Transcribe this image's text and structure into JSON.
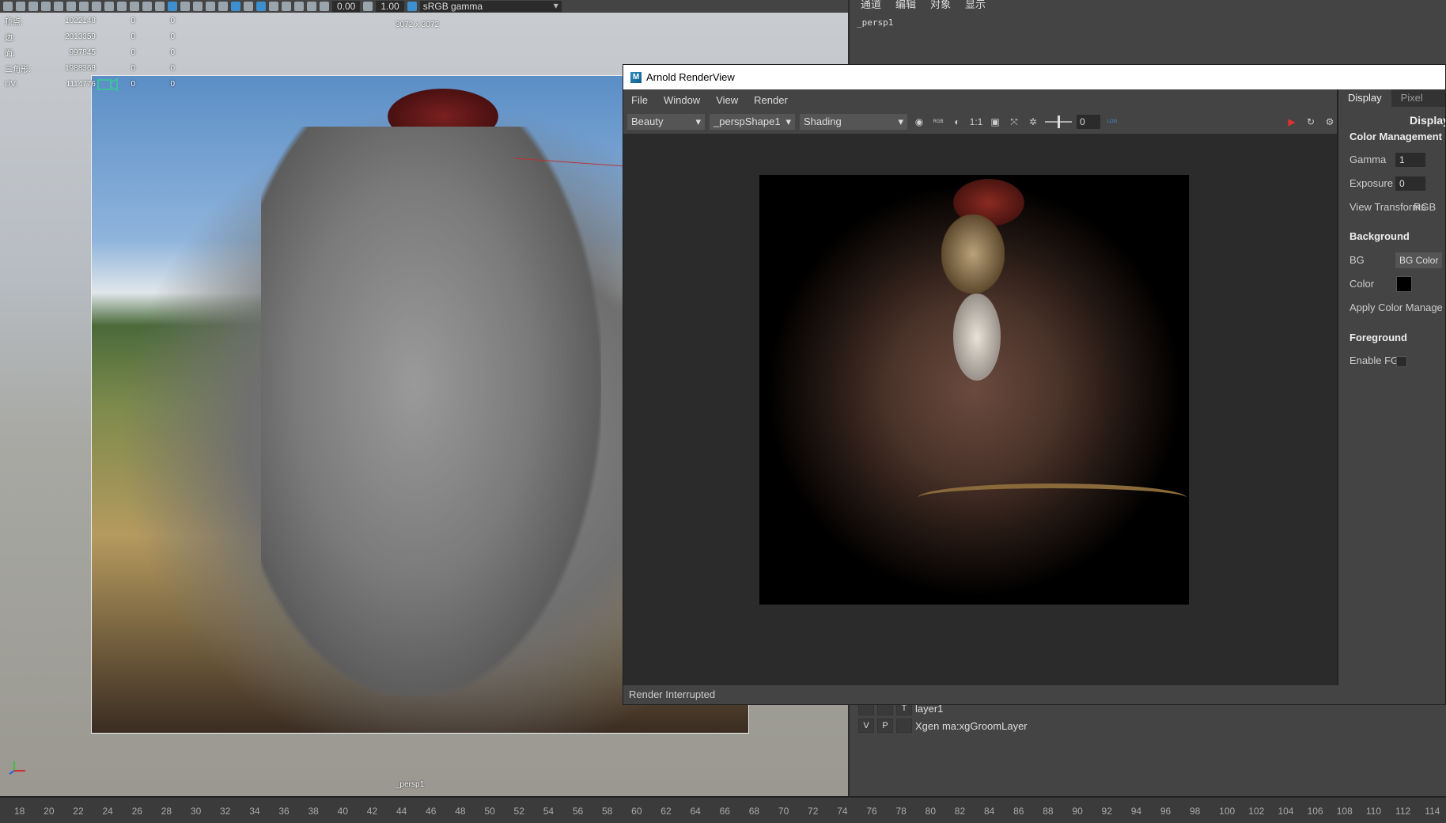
{
  "viewport": {
    "toolbar": {
      "exposure_value": "0.00",
      "gamma_value": "1.00",
      "color_space": "sRGB gamma"
    },
    "hud": {
      "rows": [
        {
          "label": "顶点:",
          "value": "1022148",
          "a": "0",
          "b": "0"
        },
        {
          "label": "边:",
          "value": "2013359",
          "a": "0",
          "b": "0"
        },
        {
          "label": "面:",
          "value": "997845",
          "a": "0",
          "b": "0"
        },
        {
          "label": "三角形:",
          "value": "1988368",
          "a": "0",
          "b": "0"
        },
        {
          "label": "UV:",
          "value": "1114776",
          "a": "0",
          "b": "0"
        }
      ]
    },
    "resolution_label": "3072 x 3072",
    "camera_label": "_persp1"
  },
  "side_panel": {
    "menu": [
      "通道",
      "编辑",
      "对象",
      "显示"
    ],
    "camera": "_persp1",
    "layers": [
      {
        "v": "",
        "p": "",
        "name": "layer1"
      },
      {
        "v": "V",
        "p": "P",
        "name": "Xgen ma:xgGroomLayer"
      }
    ]
  },
  "arnold": {
    "title": "Arnold RenderView",
    "logo": "M",
    "menu": [
      "File",
      "Window",
      "View",
      "Render"
    ],
    "toolbar": {
      "aov": "Beauty",
      "camera": "_perspShape1",
      "debug_mode": "Shading",
      "ratio_label": "1:1",
      "exposure_value": "0",
      "rgb_label": "RGB",
      "log_label": "LOG"
    },
    "status": "Render Interrupted",
    "panel": {
      "tabs": [
        "Display",
        "Pixel"
      ],
      "title": "Display",
      "color_management": "Color Management",
      "gamma_label": "Gamma",
      "gamma_value": "1",
      "exposure_label": "Exposure",
      "exposure_value": "0",
      "view_transform_label": "View Transforms",
      "view_transform_value": "RGB",
      "background": "Background",
      "bg_label": "BG",
      "bg_value": "BG Color",
      "color_label": "Color",
      "apply_cm": "Apply Color Manage",
      "foreground": "Foreground",
      "enable_fg": "Enable FG"
    }
  },
  "timeline": {
    "ticks": [
      "18",
      "20",
      "22",
      "24",
      "26",
      "28",
      "30",
      "32",
      "34",
      "36",
      "38",
      "40",
      "42",
      "44",
      "46",
      "48",
      "50",
      "52",
      "54",
      "56",
      "58",
      "60",
      "62",
      "64",
      "66",
      "68",
      "70",
      "72",
      "74",
      "76",
      "78",
      "80",
      "82",
      "84",
      "86",
      "88",
      "90",
      "92",
      "94",
      "96",
      "98",
      "100",
      "102",
      "104",
      "106",
      "108",
      "110",
      "112",
      "114"
    ]
  },
  "colors": {
    "accent": "#3d8fd0",
    "render_button": "#e03030"
  }
}
